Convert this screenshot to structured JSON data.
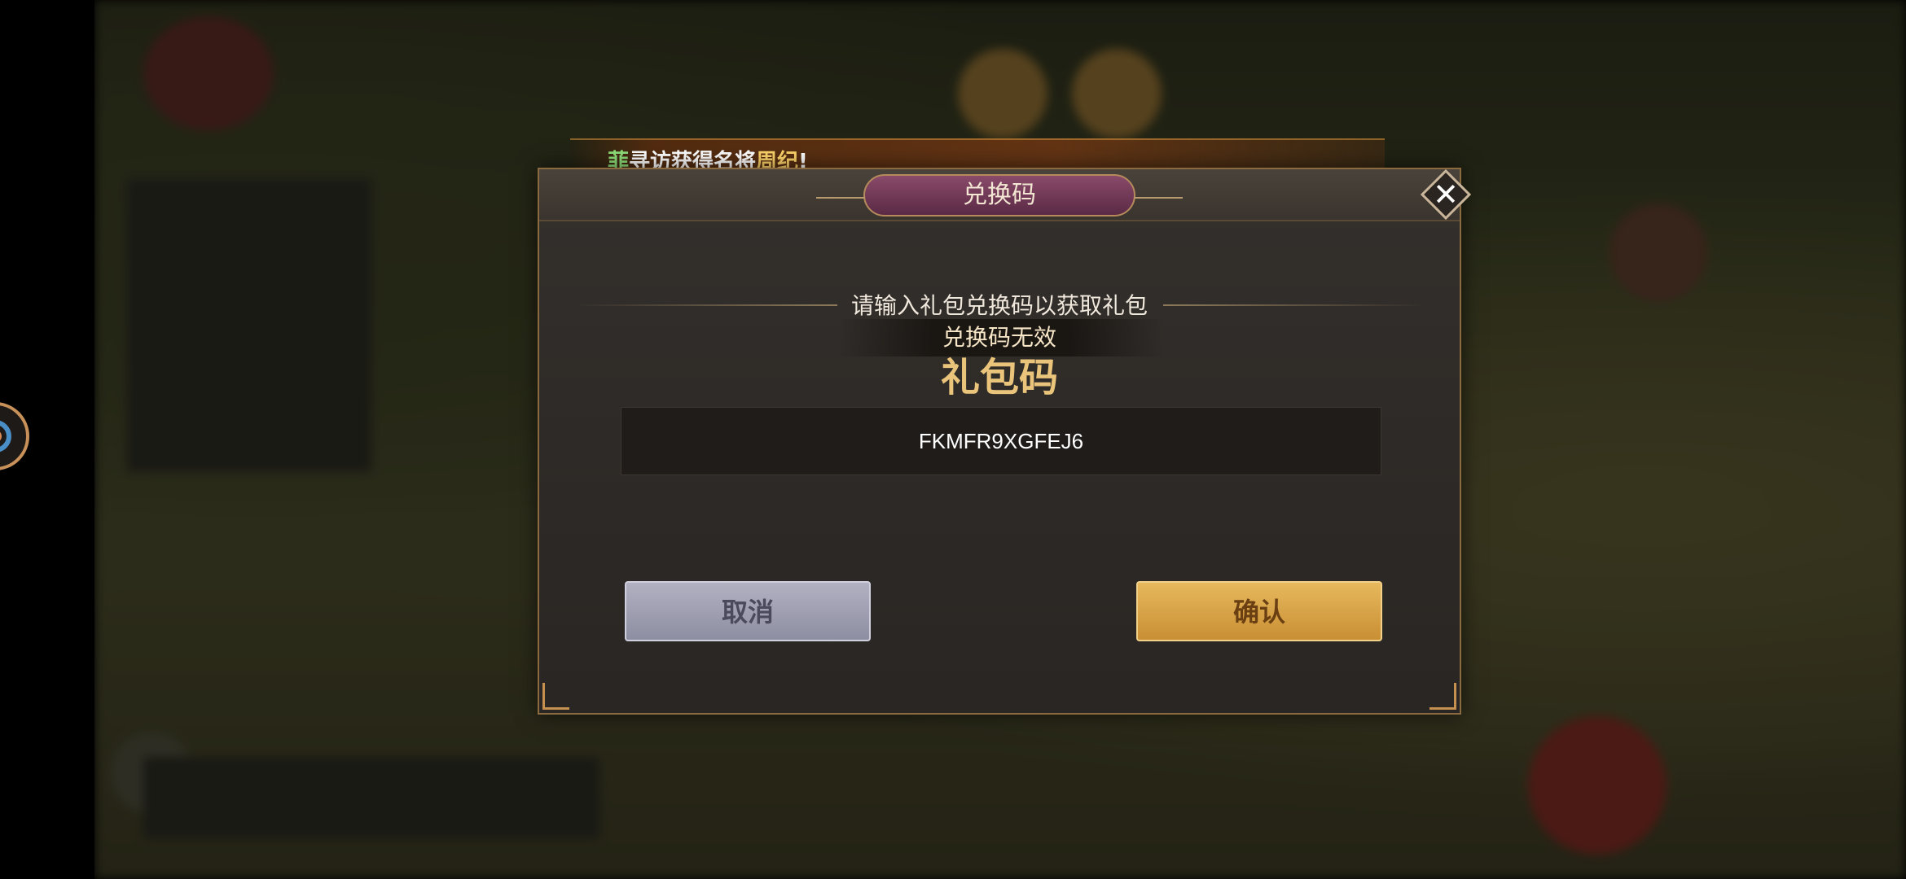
{
  "marquee": {
    "prefix": "菲",
    "text": "寻访获得名将",
    "hero": "周纪",
    "suffix": "!"
  },
  "dialog": {
    "title": "兑换码",
    "prompt": "请输入礼包兑换码以获取礼包",
    "error_message": "兑换码无效",
    "field_label": "礼包码",
    "code_value": "FKMFR9XGFEJ6",
    "cancel_label": "取消",
    "confirm_label": "确认",
    "close_icon": "close-icon"
  },
  "colors": {
    "title_plate": "#5a2a45",
    "label_gold": "#e9c47a",
    "confirm_button": "#d9a447",
    "cancel_button": "#9e9db0",
    "dialog_bg": "#2e2a27"
  }
}
